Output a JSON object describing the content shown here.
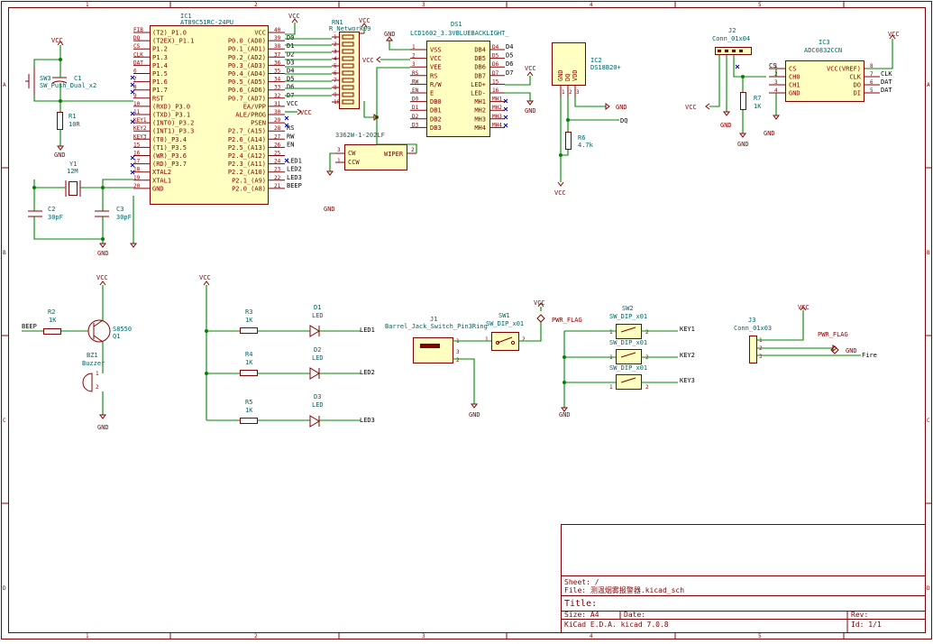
{
  "frame": {
    "col_labels": [
      "1",
      "2",
      "3",
      "4",
      "5"
    ],
    "row_labels": [
      "A",
      "B",
      "C",
      "D"
    ]
  },
  "title_block": {
    "sheet": "Sheet: /",
    "file": "File: 测温烟雾报警器.kicad_sch",
    "title": "Title:",
    "size": "Size: A4",
    "date": "Date:",
    "rev": "Rev:",
    "kicad": "KiCad E.D.A.  kicad 7.0.8",
    "id": "Id: 1/1"
  },
  "power": {
    "vcc": "VCC",
    "gnd": "GND"
  },
  "components": {
    "ic1": {
      "ref": "IC1",
      "value": "AT89C51RC-24PU",
      "left_pins": [
        {
          "num": "FIB",
          "name": "(T2)_P1.0"
        },
        {
          "num": "DQ",
          "name": "(T2EX)_P1.1"
        },
        {
          "num": "CS",
          "name": "P1.2"
        },
        {
          "num": "CLK",
          "name": "P1.3"
        },
        {
          "num": "DAT",
          "name": "P1.4"
        },
        {
          "num": "6",
          "name": "P1.5"
        },
        {
          "num": "7",
          "name": "P1.6"
        },
        {
          "num": "8",
          "name": "P1.7"
        },
        {
          "num": "9",
          "name": "RST"
        },
        {
          "num": "10",
          "name": "(RXD)_P3.0"
        },
        {
          "num": "11",
          "name": "(TXD)_P3.1"
        },
        {
          "num": "KEY1",
          "name": "(INT0)_P3.2"
        },
        {
          "num": "KEY2",
          "name": "(INT1)_P3.3"
        },
        {
          "num": "KEY3",
          "name": "(T0)_P3.4"
        },
        {
          "num": "15",
          "name": "(T1)_P3.5"
        },
        {
          "num": "16",
          "name": "(WR)_P3.6"
        },
        {
          "num": "17",
          "name": "(RD)_P3.7"
        },
        {
          "num": "18",
          "name": "XTAL2"
        },
        {
          "num": "19",
          "name": "XTAL1"
        },
        {
          "num": "20",
          "name": "GND"
        }
      ],
      "right_pins": [
        {
          "num": "40",
          "name": "VCC",
          "net": ""
        },
        {
          "num": "39",
          "name": "P0.0_(AD0)",
          "net": "D0"
        },
        {
          "num": "38",
          "name": "P0.1_(AD1)",
          "net": "D1"
        },
        {
          "num": "37",
          "name": "P0.2_(AD2)",
          "net": "D2"
        },
        {
          "num": "36",
          "name": "P0.3_(AD3)",
          "net": "D3"
        },
        {
          "num": "35",
          "name": "P0.4_(AD4)",
          "net": "D4"
        },
        {
          "num": "34",
          "name": "P0.5_(AD5)",
          "net": "D5"
        },
        {
          "num": "33",
          "name": "P0.6_(AD6)",
          "net": "D6"
        },
        {
          "num": "32",
          "name": "P0.7_(AD7)",
          "net": "D7"
        },
        {
          "num": "31",
          "name": "EA/VPP",
          "net": "VCC"
        },
        {
          "num": "30",
          "name": "ALE/PROG",
          "net": ""
        },
        {
          "num": "29",
          "name": "PSEN",
          "net": ""
        },
        {
          "num": "28",
          "name": "P2.7_(A15)",
          "net": "RS"
        },
        {
          "num": "27",
          "name": "P2.6_(A14)",
          "net": "RW"
        },
        {
          "num": "26",
          "name": "P2.5_(A13)",
          "net": "EN"
        },
        {
          "num": "25",
          "name": "P2.4_(A12)",
          "net": ""
        },
        {
          "num": "24",
          "name": "P2.3_(A11)",
          "net": "LED1"
        },
        {
          "num": "23",
          "name": "P2.2_(A10)",
          "net": "LED2"
        },
        {
          "num": "22",
          "name": "P2.1_(A9)",
          "net": "LED3"
        },
        {
          "num": "21",
          "name": "P2.0_(A8)",
          "net": "BEEP"
        }
      ]
    },
    "rn1": {
      "ref": "RN1",
      "value": "R_Network09",
      "pins": [
        "1",
        "2",
        "3",
        "4",
        "5",
        "6",
        "7",
        "8",
        "9",
        "10"
      ]
    },
    "ds1": {
      "ref": "DS1",
      "value": "LCD1602_3.3VBLUEBACKLIGHT_",
      "left_pins": [
        {
          "num": "1",
          "name": "VSS",
          "net": ""
        },
        {
          "num": "2",
          "name": "VCC",
          "net": ""
        },
        {
          "num": "3",
          "name": "VEE",
          "net": ""
        },
        {
          "num": "RS",
          "name": "RS",
          "net": ""
        },
        {
          "num": "RW",
          "name": "R/W",
          "net": ""
        },
        {
          "num": "EN",
          "name": "E",
          "net": ""
        },
        {
          "num": "D0",
          "name": "DB0",
          "net": ""
        },
        {
          "num": "D1",
          "name": "DB1",
          "net": ""
        },
        {
          "num": "D2",
          "name": "DB2",
          "net": ""
        },
        {
          "num": "D3",
          "name": "DB3",
          "net": ""
        }
      ],
      "right_pins": [
        {
          "num": "D4",
          "name": "DB4",
          "net": "D4"
        },
        {
          "num": "D5",
          "name": "DB5",
          "net": "D5"
        },
        {
          "num": "D6",
          "name": "DB6",
          "net": "D6"
        },
        {
          "num": "D7",
          "name": "DB7",
          "net": "D7"
        },
        {
          "num": "15",
          "name": "LED+",
          "net": ""
        },
        {
          "num": "16",
          "name": "LED-",
          "net": ""
        },
        {
          "num": "MH1",
          "name": "MH1",
          "net": ""
        },
        {
          "num": "MH2",
          "name": "MH2",
          "net": ""
        },
        {
          "num": "MH3",
          "name": "MH3",
          "net": ""
        },
        {
          "num": "MH4",
          "name": "MH4",
          "net": ""
        }
      ]
    },
    "pot": {
      "value": "3362W-1-202LF",
      "cw": "CW",
      "ccw": "CCW",
      "wiper": "WIPER",
      "p1": "1",
      "p2": "2",
      "p3": "3"
    },
    "ic2": {
      "ref": "IC2",
      "value": "DS18B20+",
      "pins": [
        "GND",
        "DQ",
        "VDD"
      ],
      "nums": [
        "1",
        "2",
        "3"
      ],
      "net": "DQ"
    },
    "r6": {
      "ref": "R6",
      "value": "4.7k"
    },
    "j2": {
      "ref": "J2",
      "value": "Conn_01x04"
    },
    "r7": {
      "ref": "R7",
      "value": "1K"
    },
    "ic3": {
      "ref": "IC3",
      "value": "ADC0832CCN",
      "left_pins": [
        {
          "num": "1",
          "name": "CS",
          "net": "CS"
        },
        {
          "num": "2",
          "name": "CH0",
          "net": ""
        },
        {
          "num": "3",
          "name": "CH1",
          "net": ""
        },
        {
          "num": "4",
          "name": "GND",
          "net": ""
        }
      ],
      "right_pins": [
        {
          "num": "8",
          "name": "VCC(VREF)",
          "net": ""
        },
        {
          "num": "7",
          "name": "CLK",
          "net": "CLK"
        },
        {
          "num": "6",
          "name": "DO",
          "net": "DAT"
        },
        {
          "num": "5",
          "name": "DI",
          "net": "DAT"
        }
      ]
    },
    "sw3": {
      "ref": "SW3",
      "value": "SW_Push_Dual_x2"
    },
    "c1": {
      "ref": "C1",
      "value": ""
    },
    "r1": {
      "ref": "R1",
      "value": "10R"
    },
    "y1": {
      "ref": "Y1",
      "value": "12M"
    },
    "c2": {
      "ref": "C2",
      "value": "30pF"
    },
    "c3": {
      "ref": "C3",
      "value": "30pF"
    },
    "r2": {
      "ref": "R2",
      "value": "1K",
      "net": "BEEP"
    },
    "q1": {
      "ref": "Q1",
      "value": "S8550"
    },
    "bz1": {
      "ref": "BZ1",
      "value": "Buzzer",
      "p1": "1",
      "p2": "2"
    },
    "r3": {
      "ref": "R3",
      "value": "1K"
    },
    "r4": {
      "ref": "R4",
      "value": "1K"
    },
    "r5": {
      "ref": "R5",
      "value": "1K"
    },
    "d1": {
      "ref": "D1",
      "value": "LED",
      "net": "LED1"
    },
    "d2": {
      "ref": "D2",
      "value": "LED",
      "net": "LED2"
    },
    "d3": {
      "ref": "D3",
      "value": "LED",
      "net": "LED3"
    },
    "j1": {
      "ref": "J1",
      "value": "Barrel_Jack_Switch_Pin3Ring",
      "p1": "1",
      "p2": "2",
      "p3": "3"
    },
    "sw1": {
      "ref": "SW1",
      "value": "SW_DIP_x01",
      "p1": "1",
      "p2": "2"
    },
    "pwrflag1": {
      "value": "PWR_FLAG"
    },
    "sw2": {
      "ref": "SW2",
      "value": "SW_DIP_x01"
    },
    "sw2b": {
      "value": "SW_DIP_x01"
    },
    "sw2c": {
      "value": "SW_DIP_x01"
    },
    "keys": [
      "KEY1",
      "KEY2",
      "KEY3"
    ],
    "j3": {
      "ref": "J3",
      "value": "Conn_01x03",
      "net": "Fire"
    },
    "pwrflag2": {
      "value": "PWR_FLAG"
    }
  }
}
